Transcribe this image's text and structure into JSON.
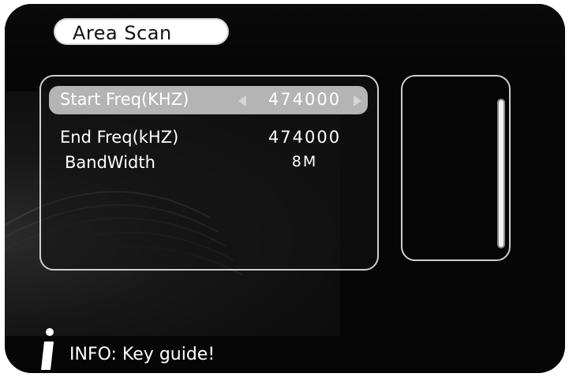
{
  "header": {
    "title": "Area Scan"
  },
  "settings": {
    "rows": [
      {
        "label": "Start Freq(KHZ)",
        "value": "474000",
        "selected": true
      },
      {
        "label": "End Freq(kHZ)",
        "value": "474000",
        "selected": false
      },
      {
        "label": "BandWidth",
        "value": "8M",
        "selected": false
      }
    ]
  },
  "footer": {
    "info_text": "INFO: Key guide!"
  },
  "icons": {
    "info": "info-icon",
    "left_arrow": "arrow-left-icon",
    "right_arrow": "arrow-right-icon"
  },
  "colors": {
    "screen_bg": "#060606",
    "selection": "#b4b4b4",
    "panel_border": "#cfcfcf",
    "text": "#ffffff"
  }
}
